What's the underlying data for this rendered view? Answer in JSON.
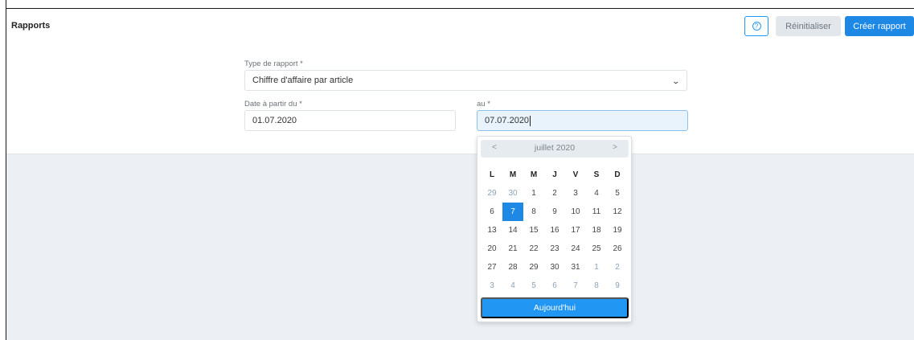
{
  "header": {
    "title": "Rapports",
    "help_icon": "question-circle-icon",
    "reset_label": "Réinitialiser",
    "create_label": "Créer rapport"
  },
  "form": {
    "report_type": {
      "label": "Type de rapport *",
      "value": "Chiffre d'affaire par article",
      "chevron": "⌄"
    },
    "date_from": {
      "label": "Date à partir du *",
      "value": "01.07.2020"
    },
    "date_to": {
      "label": "au *",
      "value": "07.07.2020"
    }
  },
  "datepicker": {
    "prev": "<",
    "next": ">",
    "month": "juillet 2020",
    "weekdays": [
      "L",
      "M",
      "M",
      "J",
      "V",
      "S",
      "D"
    ],
    "weeks": [
      [
        {
          "d": "29",
          "o": true
        },
        {
          "d": "30",
          "o": true
        },
        {
          "d": "1"
        },
        {
          "d": "2"
        },
        {
          "d": "3"
        },
        {
          "d": "4"
        },
        {
          "d": "5"
        }
      ],
      [
        {
          "d": "6"
        },
        {
          "d": "7",
          "s": true
        },
        {
          "d": "8"
        },
        {
          "d": "9"
        },
        {
          "d": "10"
        },
        {
          "d": "11"
        },
        {
          "d": "12"
        }
      ],
      [
        {
          "d": "13"
        },
        {
          "d": "14"
        },
        {
          "d": "15"
        },
        {
          "d": "16"
        },
        {
          "d": "17"
        },
        {
          "d": "18"
        },
        {
          "d": "19"
        }
      ],
      [
        {
          "d": "20"
        },
        {
          "d": "21"
        },
        {
          "d": "22"
        },
        {
          "d": "23"
        },
        {
          "d": "24"
        },
        {
          "d": "25"
        },
        {
          "d": "26"
        }
      ],
      [
        {
          "d": "27"
        },
        {
          "d": "28"
        },
        {
          "d": "29"
        },
        {
          "d": "30"
        },
        {
          "d": "31"
        },
        {
          "d": "1",
          "o": true
        },
        {
          "d": "2",
          "o": true
        }
      ],
      [
        {
          "d": "3",
          "o": true
        },
        {
          "d": "4",
          "o": true
        },
        {
          "d": "5",
          "o": true
        },
        {
          "d": "6",
          "o": true
        },
        {
          "d": "7",
          "o": true
        },
        {
          "d": "8",
          "o": true
        },
        {
          "d": "9",
          "o": true
        }
      ]
    ],
    "today_label": "Aujourd'hui"
  },
  "colors": {
    "primary": "#1e88e5",
    "other_month": "#8ba3ba",
    "background": "#eceff3"
  }
}
